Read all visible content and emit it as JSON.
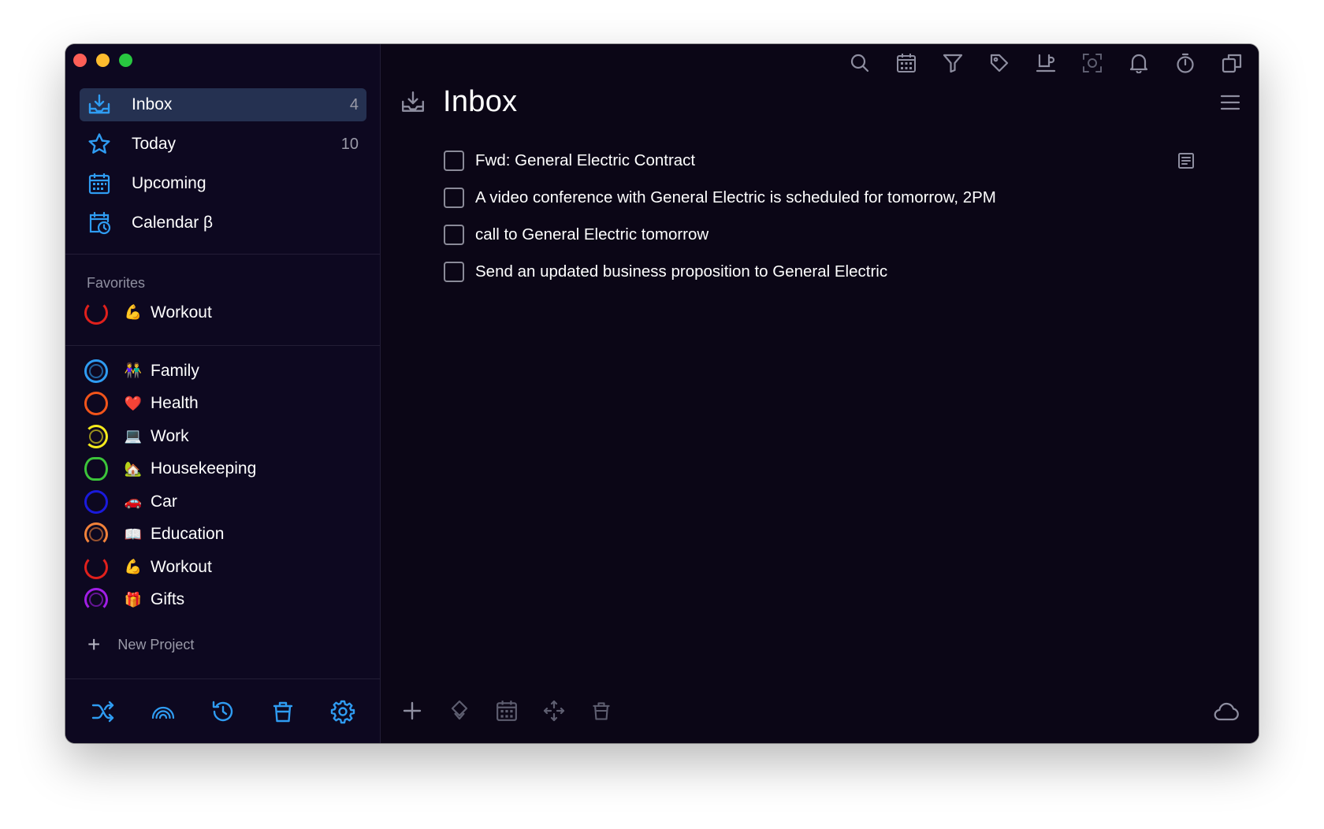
{
  "colors": {
    "window_bg": "#0b0616",
    "sidebar_bg": "#0d0820",
    "active_row": "#253151",
    "accent_blue": "#2f9cf2",
    "muted_icon": "#8e8ea0"
  },
  "nav": {
    "items": [
      {
        "label": "Inbox",
        "count": "4",
        "icon": "inbox-icon"
      },
      {
        "label": "Today",
        "count": "10",
        "icon": "star-icon"
      },
      {
        "label": "Upcoming",
        "count": "",
        "icon": "calendar-grid-icon"
      },
      {
        "label": "Calendar β",
        "count": "",
        "icon": "calendar-clock-icon"
      }
    ]
  },
  "favorites": {
    "title": "Favorites",
    "items": [
      {
        "emoji": "💪",
        "label": "Workout",
        "color": "#e0201c"
      }
    ]
  },
  "projects": {
    "items": [
      {
        "emoji": "👫",
        "label": "Family",
        "color": "#2f9cf2"
      },
      {
        "emoji": "❤️",
        "label": "Health",
        "color": "#f2541a"
      },
      {
        "emoji": "💻",
        "label": "Work",
        "color": "#f5ea1c"
      },
      {
        "emoji": "🏡",
        "label": "Housekeeping",
        "color": "#3cc43a"
      },
      {
        "emoji": "🚗",
        "label": "Car",
        "color": "#1a1adb"
      },
      {
        "emoji": "📖",
        "label": "Education",
        "color": "#f2823a"
      },
      {
        "emoji": "💪",
        "label": "Workout",
        "color": "#e0201c"
      },
      {
        "emoji": "🎁",
        "label": "Gifts",
        "color": "#a11ee6"
      }
    ],
    "new_project_label": "New Project"
  },
  "sidebar_bottom": {
    "icons": [
      "shuffle-icon",
      "rainbow-icon",
      "history-icon",
      "trash-icon",
      "settings-icon"
    ]
  },
  "toolbar": {
    "icons": [
      "search-icon",
      "calendar-icon",
      "filter-icon",
      "tag-icon",
      "coffee-icon",
      "focus-icon",
      "bell-icon",
      "timer-icon",
      "copy-icon"
    ]
  },
  "main": {
    "title": "Inbox",
    "tasks": [
      {
        "text": "Fwd: General Electric Contract",
        "has_note": true
      },
      {
        "text": "A video conference with General Electric is scheduled for tomorrow, 2PM",
        "has_note": false
      },
      {
        "text": "call to General Electric tomorrow",
        "has_note": false
      },
      {
        "text": "Send an updated business proposition to General Electric",
        "has_note": false
      }
    ]
  },
  "main_bottom": {
    "icons": [
      "add-icon",
      "priority-icon",
      "schedule-icon",
      "move-icon",
      "delete-icon",
      "cloud-icon"
    ]
  }
}
